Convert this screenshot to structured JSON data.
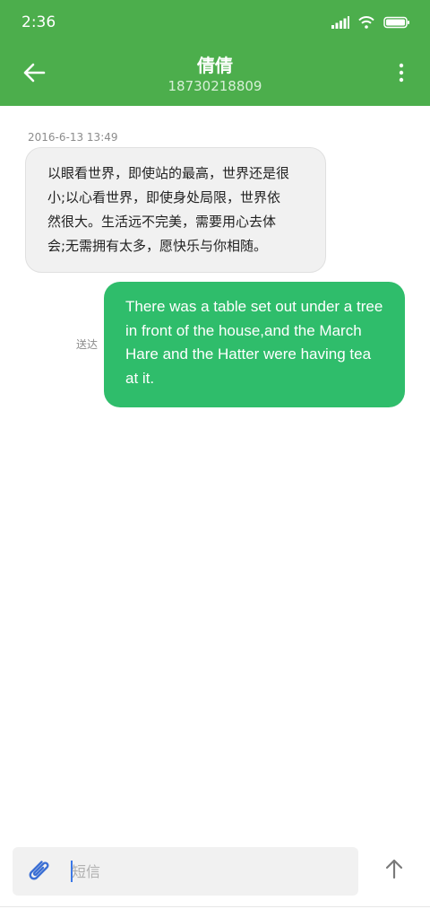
{
  "status_bar": {
    "time": "2:36",
    "icons": [
      "signal-icon",
      "wifi-icon",
      "battery-icon"
    ]
  },
  "header": {
    "contact_name": "倩倩",
    "contact_number": "18730218809",
    "back_icon": "arrow-left-icon",
    "more_icon": "more-vertical-icon"
  },
  "conversation": {
    "timestamp": "2016-6-13 13:49",
    "incoming_lines": [
      "以眼看世界，即使站的最高，世界还是很",
      "小;以心看世界，即使身处局限，世界依",
      "然很大。生活远不完美，需要用心去体",
      "会;无需拥有太多，愿快乐与你相随。"
    ],
    "sent_status": "送达",
    "outgoing_lines": [
      "There was a table set out under a tree",
      "in front of the house,and the March",
      "Hare and the Hatter were having tea",
      "at it."
    ]
  },
  "composer": {
    "placeholder": "短信",
    "attach_icon": "paperclip-icon",
    "send_icon": "arrow-up-icon"
  },
  "colors": {
    "header": "#4cae4c",
    "outgoing_bubble": "#2fbd6b",
    "incoming_bubble": "#f1f1f1",
    "accent": "#3b78e7"
  }
}
